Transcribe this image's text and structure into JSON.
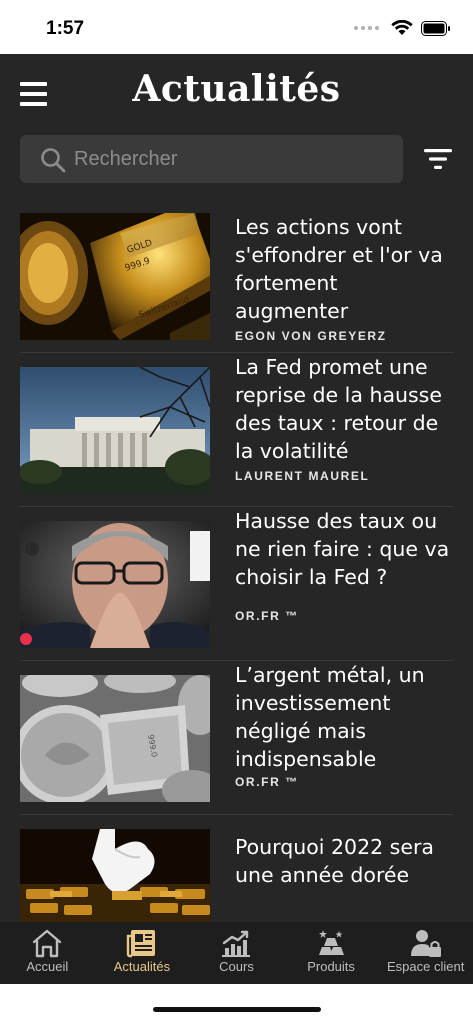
{
  "status_bar": {
    "time": "1:57"
  },
  "header": {
    "title": "Actualités"
  },
  "search": {
    "placeholder": "Rechercher"
  },
  "news": [
    {
      "title": "Les actions vont s'effondrer et l'or va fortement augmenter",
      "author": "EGON VON GREYERZ",
      "image": "gold-bars-image"
    },
    {
      "title": "La Fed promet une reprise de la hausse des taux : retour de la volatilité",
      "author": "LAURENT MAUREL",
      "image": "federal-reserve-building-image"
    },
    {
      "title": "Hausse des taux ou ne rien faire : que va choisir la Fed ?",
      "author": "OR.FR ™",
      "image": "fed-chairman-portrait-image"
    },
    {
      "title": "L’argent métal, un investissement négligé mais indispensable",
      "author": "OR.FR ™",
      "image": "silver-coins-bars-image"
    },
    {
      "title": "Pourquoi 2022 sera une année dorée",
      "author": "",
      "image": "gloved-hand-gold-bars-image"
    }
  ],
  "tabs": [
    {
      "label": "Accueil",
      "icon": "home-icon"
    },
    {
      "label": "Actualités",
      "icon": "newspaper-icon",
      "active": true
    },
    {
      "label": "Cours",
      "icon": "chart-icon"
    },
    {
      "label": "Produits",
      "icon": "gold-bars-icon"
    },
    {
      "label": "Espace client",
      "icon": "user-lock-icon"
    }
  ],
  "colors": {
    "background": "#262626",
    "accent": "#e8c88a",
    "tab_bar": "#1e1e1e"
  }
}
